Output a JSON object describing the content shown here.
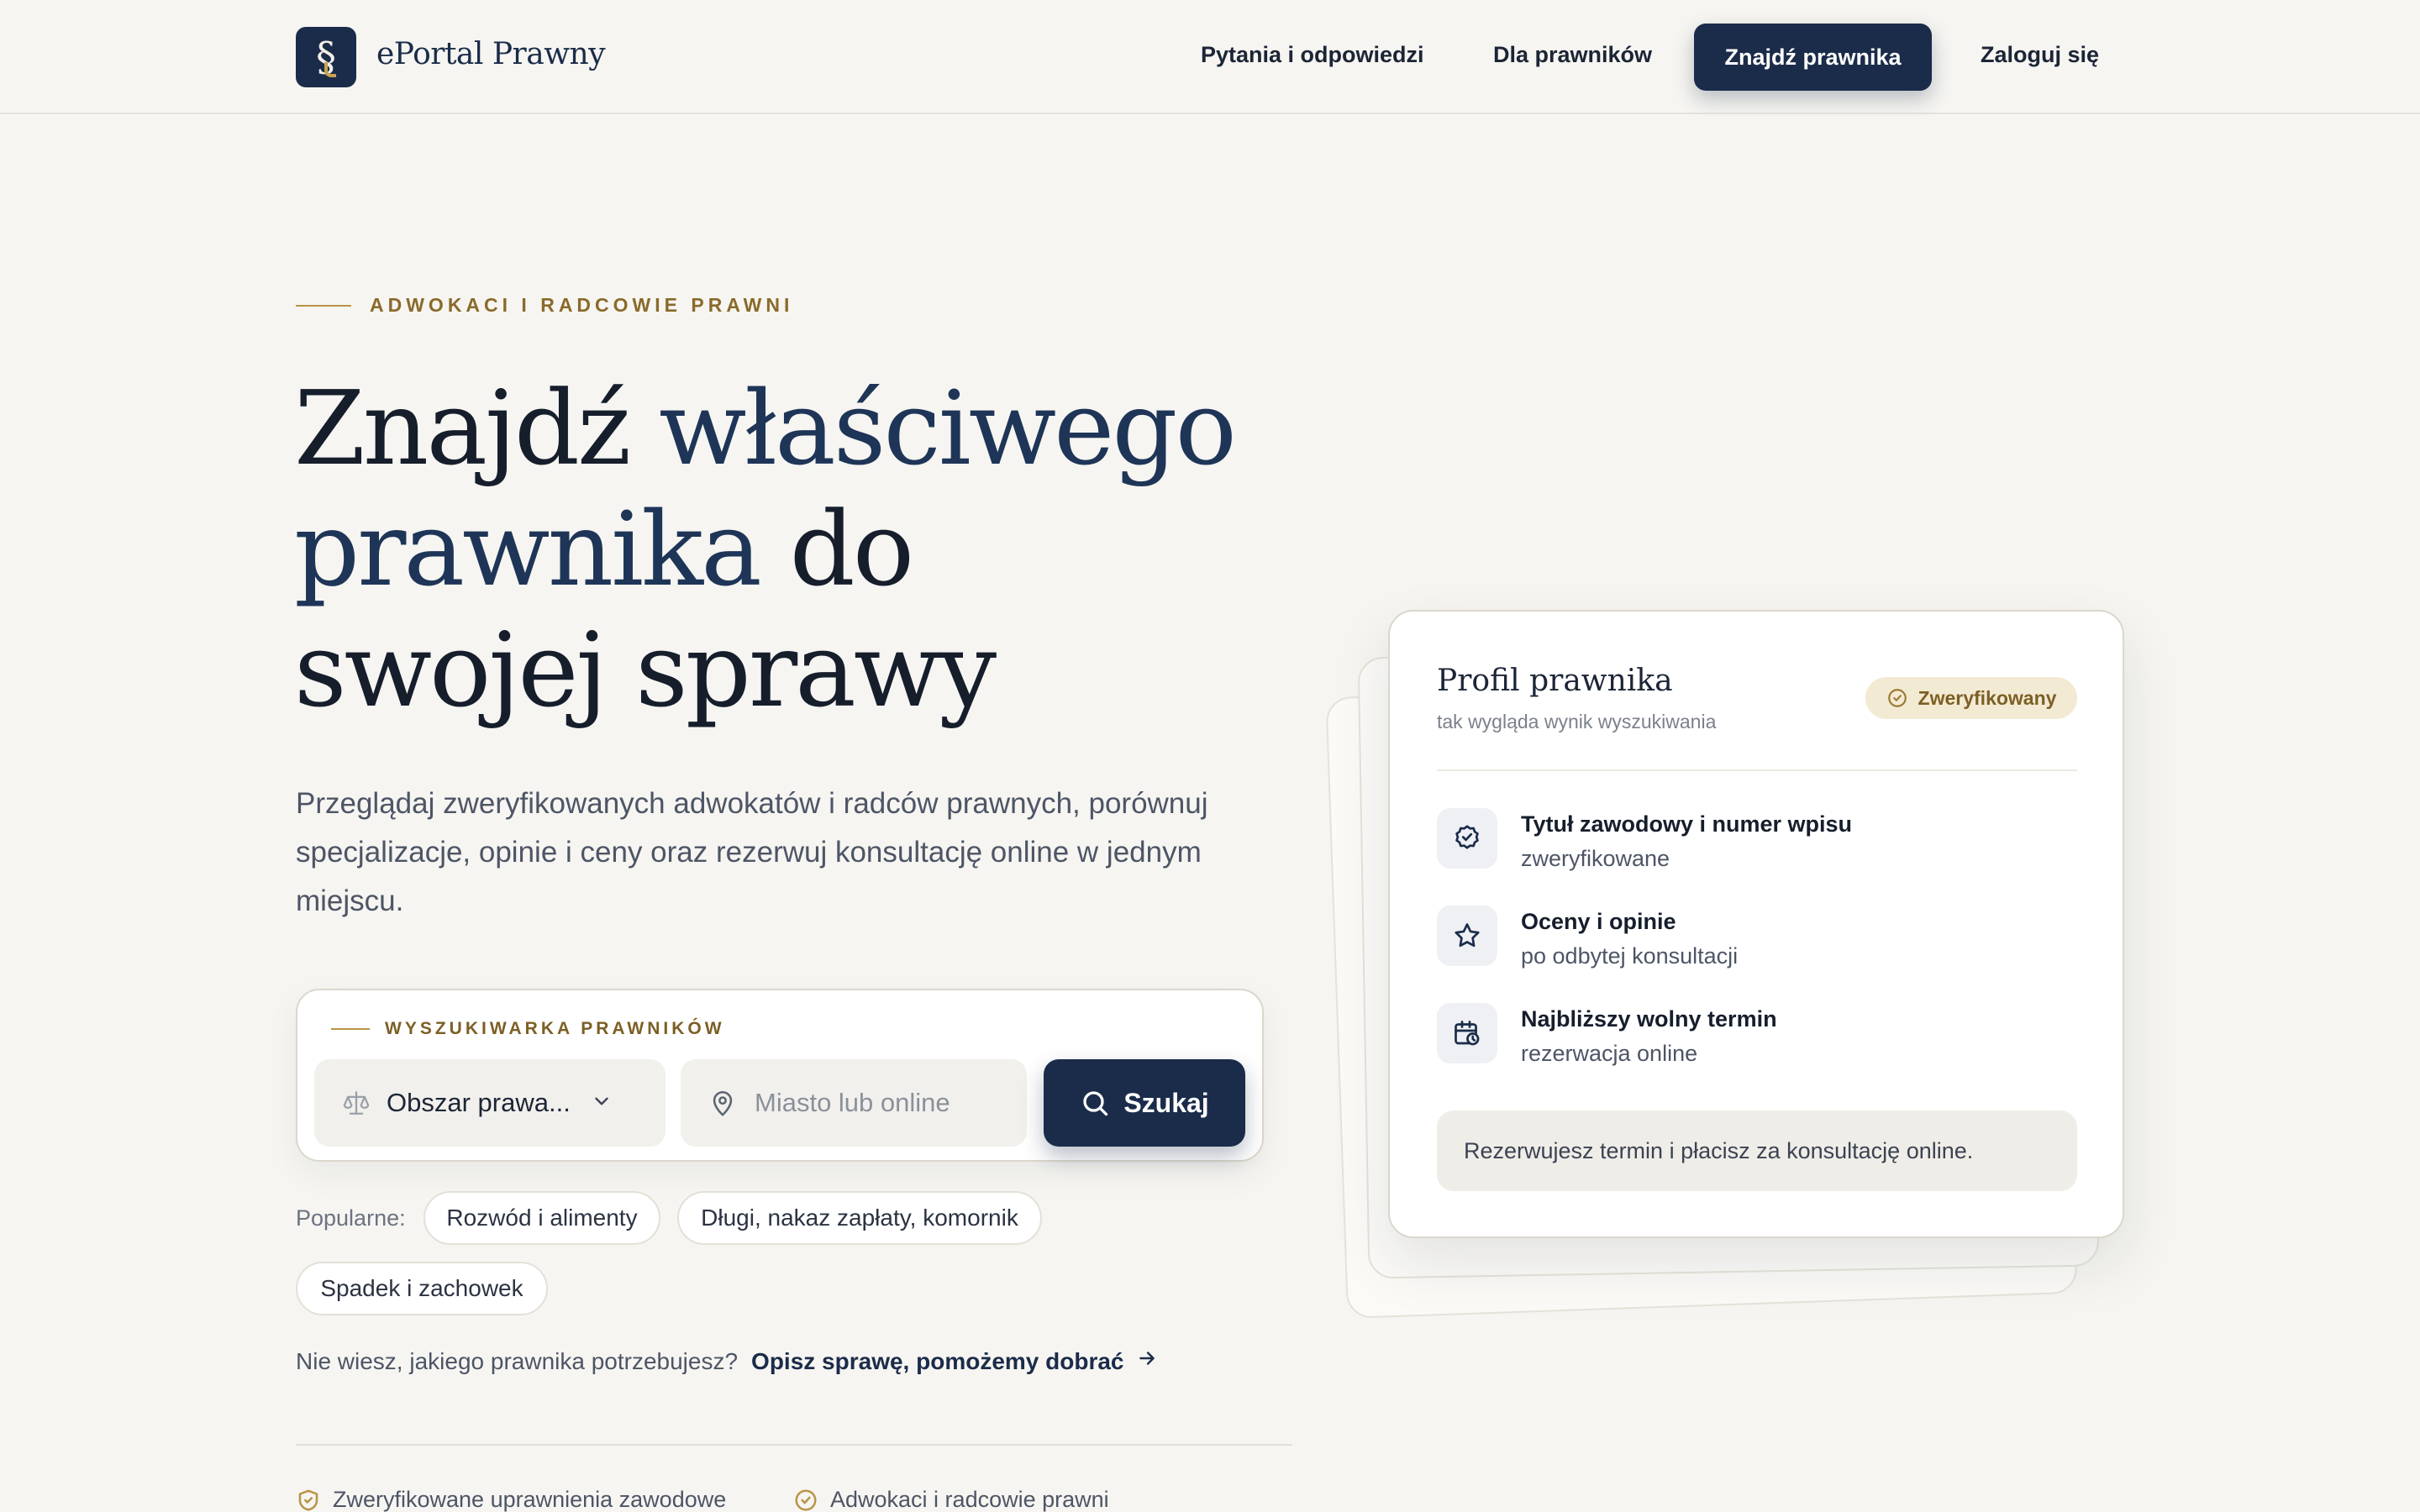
{
  "header": {
    "logo_symbol": "§",
    "brand": "ePortal Prawny",
    "nav": {
      "qa": "Pytania i odpowiedzi",
      "lawyers": "Dla prawników",
      "find": "Znajdź prawnika",
      "login": "Zaloguj się"
    }
  },
  "hero": {
    "eyebrow": "ADWOKACI I RADCOWIE PRAWNI",
    "headline": {
      "line1a": "Znajdź ",
      "line1b": "właściwego",
      "line2a": "prawnika",
      "line2b": " do",
      "line3": "swojej sprawy"
    },
    "subtitle": "Przeglądaj zweryfikowanych adwokatów i radców prawnych, porównuj specjalizacje, opinie i ceny oraz rezerwuj konsultację online w jednym miejscu."
  },
  "search": {
    "label": "WYSZUKIWARKA PRAWNIKÓW",
    "area_value": "Obszar prawa...",
    "city_placeholder": "Miasto lub online",
    "button": "Szukaj"
  },
  "popular": {
    "label": "Popularne:",
    "chips": [
      "Rozwód i alimenty",
      "Długi, nakaz zapłaty, komornik",
      "Spadek i zachowek"
    ]
  },
  "help": {
    "question": "Nie wiesz, jakiego prawnika potrzebujesz?",
    "link": "Opisz sprawę, pomożemy dobrać"
  },
  "trust": [
    "Zweryfikowane uprawnienia zawodowe",
    "Adwokaci i radcowie prawni"
  ],
  "card": {
    "title": "Profil prawnika",
    "subtitle": "tak wygląda wynik wyszukiwania",
    "badge": "Zweryfikowany",
    "features": [
      {
        "title": "Tytuł zawodowy i numer wpisu",
        "sub": "zweryfikowane"
      },
      {
        "title": "Oceny i opinie",
        "sub": "po odbytej konsultacji"
      },
      {
        "title": "Najbliższy wolny termin",
        "sub": "rezerwacja online"
      }
    ],
    "note": "Rezerwujesz termin i płacisz za konsultację online."
  },
  "colors": {
    "navy": "#1b2c4a",
    "gold": "#b89447",
    "background": "#f6f5f1"
  }
}
